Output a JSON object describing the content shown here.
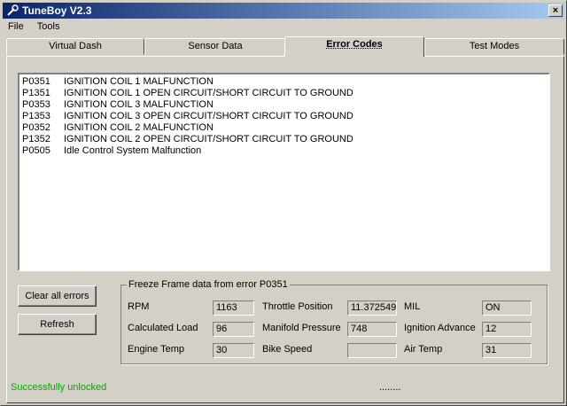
{
  "window": {
    "title": "TuneBoy V2.3",
    "close_label": "×"
  },
  "menu": [
    "File",
    "Tools"
  ],
  "tabs": [
    "Virtual Dash",
    "Sensor Data",
    "Error Codes",
    "Test Modes"
  ],
  "active_tab": "Error Codes",
  "errors": [
    {
      "code": "P0351",
      "desc": "IGNITION COIL 1 MALFUNCTION"
    },
    {
      "code": "P1351",
      "desc": "IGNITION COIL 1 OPEN CIRCUIT/SHORT CIRCUIT TO GROUND"
    },
    {
      "code": "P0353",
      "desc": "IGNITION COIL 3 MALFUNCTION"
    },
    {
      "code": "P1353",
      "desc": "IGNITION COIL 3 OPEN CIRCUIT/SHORT CIRCUIT TO GROUND"
    },
    {
      "code": "P0352",
      "desc": "IGNITION COIL 2 MALFUNCTION"
    },
    {
      "code": "P1352",
      "desc": "IGNITION COIL 2 OPEN CIRCUIT/SHORT CIRCUIT TO GROUND"
    },
    {
      "code": "P0505",
      "desc": "Idle Control System Malfunction"
    }
  ],
  "buttons": {
    "clear_all": "Clear all errors",
    "refresh": "Refresh"
  },
  "freeze": {
    "title": "Freeze Frame data from error P0351",
    "fields": [
      {
        "label": "RPM",
        "value": "1163"
      },
      {
        "label": "Calculated Load",
        "value": "96"
      },
      {
        "label": "Engine Temp",
        "value": "30"
      },
      {
        "label": "Throttle Position",
        "value": "11.372549"
      },
      {
        "label": "Manifold Pressure",
        "value": "748"
      },
      {
        "label": "Bike Speed",
        "value": ""
      },
      {
        "label": "MIL",
        "value": "ON"
      },
      {
        "label": "Ignition Advance",
        "value": "12"
      },
      {
        "label": "Air Temp",
        "value": "31"
      }
    ]
  },
  "status": {
    "message": "Successfully unlocked",
    "progress": "........"
  },
  "colors": {
    "status_green": "#00aa00",
    "titlebar": "#0a246a"
  }
}
